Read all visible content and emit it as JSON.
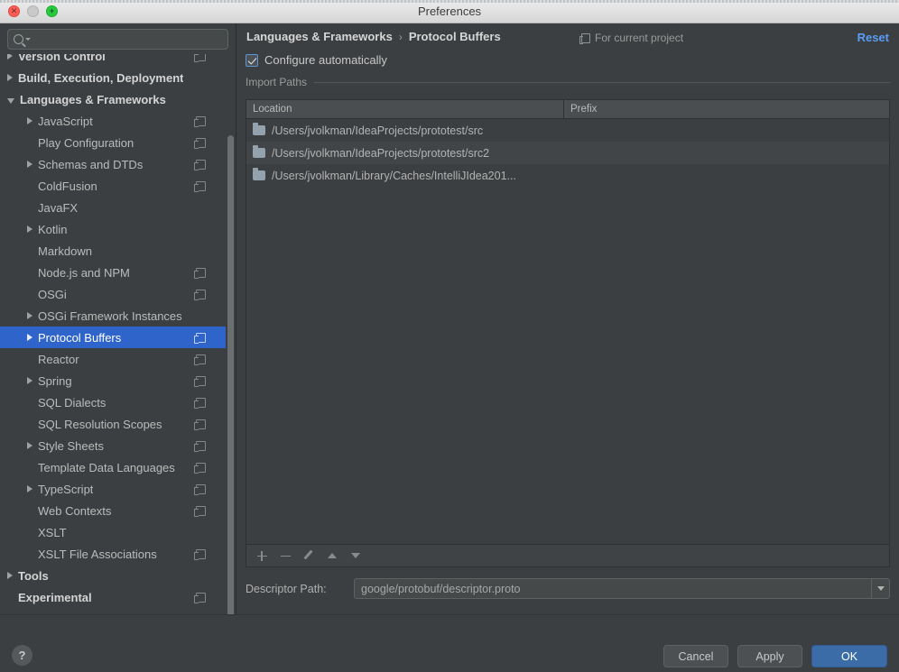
{
  "window": {
    "title": "Preferences"
  },
  "traffic": {
    "close": "close-window",
    "minimize": "minimize-window",
    "zoom": "zoom-window"
  },
  "search": {
    "value": "",
    "placeholder": ""
  },
  "sidebar": {
    "items": [
      {
        "label": "Version Control",
        "level": 0,
        "arrow": "closed",
        "bold": true,
        "badge": true,
        "selected": false,
        "clipped": true
      },
      {
        "label": "Build, Execution, Deployment",
        "level": 0,
        "arrow": "closed",
        "bold": true,
        "badge": false,
        "selected": false
      },
      {
        "label": "Languages & Frameworks",
        "level": 0,
        "arrow": "open",
        "bold": true,
        "badge": false,
        "selected": false
      },
      {
        "label": "JavaScript",
        "level": 1,
        "arrow": "closed",
        "bold": false,
        "badge": true,
        "selected": false
      },
      {
        "label": "Play Configuration",
        "level": 1,
        "arrow": "none",
        "bold": false,
        "badge": true,
        "selected": false
      },
      {
        "label": "Schemas and DTDs",
        "level": 1,
        "arrow": "closed",
        "bold": false,
        "badge": true,
        "selected": false
      },
      {
        "label": "ColdFusion",
        "level": 1,
        "arrow": "none",
        "bold": false,
        "badge": true,
        "selected": false
      },
      {
        "label": "JavaFX",
        "level": 1,
        "arrow": "none",
        "bold": false,
        "badge": false,
        "selected": false
      },
      {
        "label": "Kotlin",
        "level": 1,
        "arrow": "closed",
        "bold": false,
        "badge": false,
        "selected": false
      },
      {
        "label": "Markdown",
        "level": 1,
        "arrow": "none",
        "bold": false,
        "badge": false,
        "selected": false
      },
      {
        "label": "Node.js and NPM",
        "level": 1,
        "arrow": "none",
        "bold": false,
        "badge": true,
        "selected": false
      },
      {
        "label": "OSGi",
        "level": 1,
        "arrow": "none",
        "bold": false,
        "badge": true,
        "selected": false
      },
      {
        "label": "OSGi Framework Instances",
        "level": 1,
        "arrow": "closed",
        "bold": false,
        "badge": false,
        "selected": false
      },
      {
        "label": "Protocol Buffers",
        "level": 1,
        "arrow": "closed",
        "bold": false,
        "badge": true,
        "selected": true
      },
      {
        "label": "Reactor",
        "level": 1,
        "arrow": "none",
        "bold": false,
        "badge": true,
        "selected": false
      },
      {
        "label": "Spring",
        "level": 1,
        "arrow": "closed",
        "bold": false,
        "badge": true,
        "selected": false
      },
      {
        "label": "SQL Dialects",
        "level": 1,
        "arrow": "none",
        "bold": false,
        "badge": true,
        "selected": false
      },
      {
        "label": "SQL Resolution Scopes",
        "level": 1,
        "arrow": "none",
        "bold": false,
        "badge": true,
        "selected": false
      },
      {
        "label": "Style Sheets",
        "level": 1,
        "arrow": "closed",
        "bold": false,
        "badge": true,
        "selected": false
      },
      {
        "label": "Template Data Languages",
        "level": 1,
        "arrow": "none",
        "bold": false,
        "badge": true,
        "selected": false
      },
      {
        "label": "TypeScript",
        "level": 1,
        "arrow": "closed",
        "bold": false,
        "badge": true,
        "selected": false
      },
      {
        "label": "Web Contexts",
        "level": 1,
        "arrow": "none",
        "bold": false,
        "badge": true,
        "selected": false
      },
      {
        "label": "XSLT",
        "level": 1,
        "arrow": "none",
        "bold": false,
        "badge": false,
        "selected": false
      },
      {
        "label": "XSLT File Associations",
        "level": 1,
        "arrow": "none",
        "bold": false,
        "badge": true,
        "selected": false
      },
      {
        "label": "Tools",
        "level": 0,
        "arrow": "closed",
        "bold": true,
        "badge": false,
        "selected": false
      },
      {
        "label": "Experimental",
        "level": 0,
        "arrow": "none",
        "bold": true,
        "badge": true,
        "selected": false
      }
    ]
  },
  "pane": {
    "breadcrumb": {
      "parent": "Languages & Frameworks",
      "separator": "›",
      "current": "Protocol Buffers"
    },
    "scope_label": "For current project",
    "reset_label": "Reset",
    "configure_automatically": {
      "label": "Configure automatically",
      "checked": true
    },
    "section_title": "Import Paths",
    "table": {
      "columns": [
        "Location",
        "Prefix"
      ],
      "rows": [
        {
          "location": "/Users/jvolkman/IdeaProjects/prototest/src",
          "prefix": ""
        },
        {
          "location": "/Users/jvolkman/IdeaProjects/prototest/src2",
          "prefix": ""
        },
        {
          "location": "/Users/jvolkman/Library/Caches/IntelliJIdea201...",
          "prefix": ""
        }
      ]
    },
    "table_toolbar": [
      {
        "name": "add-import-path-button",
        "icon": "plus-icon"
      },
      {
        "name": "remove-import-path-button",
        "icon": "minus-icon"
      },
      {
        "name": "edit-import-path-button",
        "icon": "pencil-icon"
      },
      {
        "name": "move-up-button",
        "icon": "arrow-up-icon"
      },
      {
        "name": "move-down-button",
        "icon": "arrow-down-icon"
      }
    ],
    "descriptor": {
      "label": "Descriptor Path:",
      "value": "google/protobuf/descriptor.proto"
    }
  },
  "footer": {
    "help_label": "?",
    "cancel_label": "Cancel",
    "apply_label": "Apply",
    "ok_label": "OK"
  },
  "colors": {
    "window_bg": "#3c3f41",
    "selection_blue": "#2f65ca",
    "link_blue": "#589df6",
    "primary_button": "#3b6ca8",
    "titlebar": "#e4e4e4"
  }
}
